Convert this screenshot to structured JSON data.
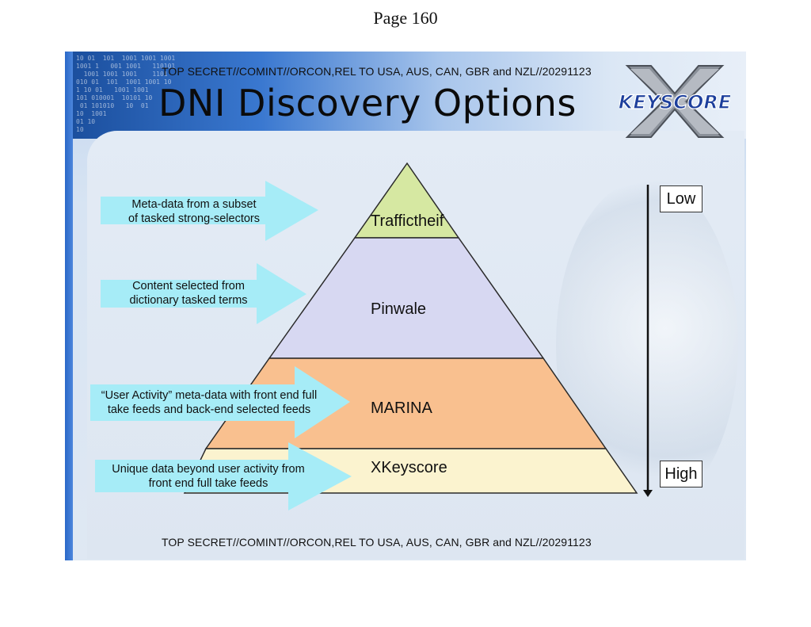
{
  "page": {
    "number": "Page 160"
  },
  "slide": {
    "classification_top": "TOP SECRET//COMINT//ORCON,REL TO USA, AUS, CAN, GBR and NZL//20291123",
    "classification_bottom": "TOP SECRET//COMINT//ORCON,REL TO USA, AUS, CAN, GBR and NZL//20291123",
    "title": "DNI Discovery Options",
    "logo_text": "KEYSCORE",
    "binary_text": "10 01  101  1001 1001 1001\n1001 1   001 1001   110101\n  1001 1001 1001    1101\n010 01  101  1001 1001 10\n1 10 01   1001 1001\n101 010001  10101 10\n 01 101010   10  01\n10  1001\n01 10\n10",
    "colors": {
      "traffic": "#d6e8a2",
      "pinwale": "#d7d8f2",
      "marina": "#f9c08f",
      "xkeyscore": "#fbf3cf",
      "arrow": "#a6ecf7"
    },
    "levels": [
      {
        "label": "Traffictheif",
        "color": "#d6e8a2"
      },
      {
        "label": "Pinwale",
        "color": "#d7d8f2"
      },
      {
        "label": "MARINA",
        "color": "#f9c08f"
      },
      {
        "label": "XKeyscore",
        "color": "#fbf3cf"
      }
    ],
    "arrows": [
      {
        "line1": "Meta-data from a subset",
        "line2": "of tasked strong-selectors"
      },
      {
        "line1": "Content selected from",
        "line2": "dictionary tasked terms"
      },
      {
        "line1": "“User Activity” meta-data with front end full",
        "line2": "take feeds and back-end selected feeds"
      },
      {
        "line1": "Unique data beyond user activity from",
        "line2": "front end full take feeds"
      }
    ],
    "scale": {
      "low": "Low",
      "high": "High"
    }
  }
}
